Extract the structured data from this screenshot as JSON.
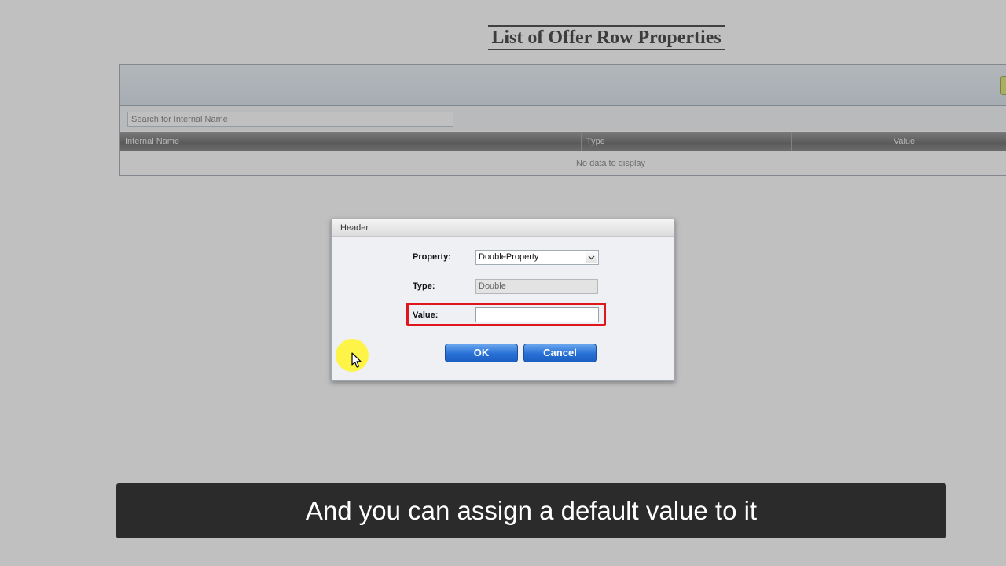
{
  "page": {
    "title": "List of Offer Row Properties",
    "search_placeholder": "Search for Internal Name",
    "columns": [
      "Internal Name",
      "Type",
      "Value"
    ],
    "empty_text": "No data to display"
  },
  "dialog": {
    "header": "Header",
    "property_label": "Property:",
    "property_value": "DoubleProperty",
    "type_label": "Type:",
    "type_value": "Double",
    "value_label": "Value:",
    "value_input": "",
    "ok_label": "OK",
    "cancel_label": "Cancel"
  },
  "caption": "And you can assign a default value to it",
  "colors": {
    "highlight": "#e0161e",
    "button": "#2770d6",
    "cursor_glow": "#fff528"
  },
  "icons": [
    "chevron-down-icon",
    "mouse-pointer-icon"
  ]
}
